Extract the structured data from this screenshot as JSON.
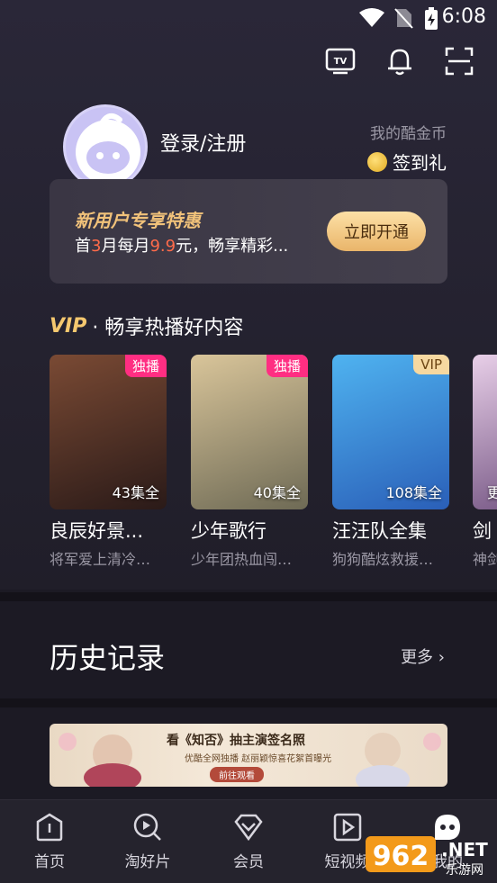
{
  "status_bar": {
    "time": "6:08"
  },
  "profile": {
    "login_label": "登录/注册",
    "coins_label": "我的酷金币",
    "checkin_label": "签到礼"
  },
  "promo": {
    "title": "新用户专享特惠",
    "line_prefix": "首",
    "line_num1": "3",
    "line_mid": "月每月",
    "line_num2": "9.9",
    "line_suffix": "元，畅享精彩...",
    "button": "立即开通"
  },
  "vip_section": {
    "vip": "VIP",
    "title": "· 畅享热播好内容"
  },
  "cards": [
    {
      "tag": "独播",
      "tag_type": "excl",
      "episodes": "43集全",
      "title": "良辰好景...",
      "subtitle": "将军爱上清冷…",
      "colors": [
        "#6b3f2c",
        "#2a1a18"
      ]
    },
    {
      "tag": "独播",
      "tag_type": "excl",
      "episodes": "40集全",
      "title": "少年歌行",
      "subtitle": "少年团热血闯…",
      "colors": [
        "#cbb58a",
        "#6e6a55"
      ]
    },
    {
      "tag": "VIP",
      "tag_type": "vip",
      "episodes": "108集全",
      "title": "汪汪队全集",
      "subtitle": "狗狗酷炫救援…",
      "colors": [
        "#3fa3e6",
        "#2f6cc2"
      ]
    },
    {
      "tag": "",
      "tag_type": "",
      "episodes": "更",
      "title": "剑",
      "subtitle": "神剑",
      "colors": [
        "#e6c6e6",
        "#6a4a7a"
      ]
    }
  ],
  "history": {
    "title": "历史记录",
    "more": "更多"
  },
  "banner": {
    "title": "看《知否》抽主演签名照",
    "subtitle": "优酷全网独播  赵丽颖惊喜花絮首曝光",
    "cta": "前往观看"
  },
  "tabbar": {
    "items": [
      {
        "label": "首页",
        "icon": "home-icon"
      },
      {
        "label": "淘好片",
        "icon": "discover-icon"
      },
      {
        "label": "会员",
        "icon": "vip-diamond-icon"
      },
      {
        "label": "短视频",
        "icon": "short-video-icon"
      },
      {
        "label": "我的",
        "icon": "profile-icon"
      }
    ]
  },
  "watermark": {
    "text1": "962",
    "text2": ".NET",
    "text3": "乐游网"
  }
}
